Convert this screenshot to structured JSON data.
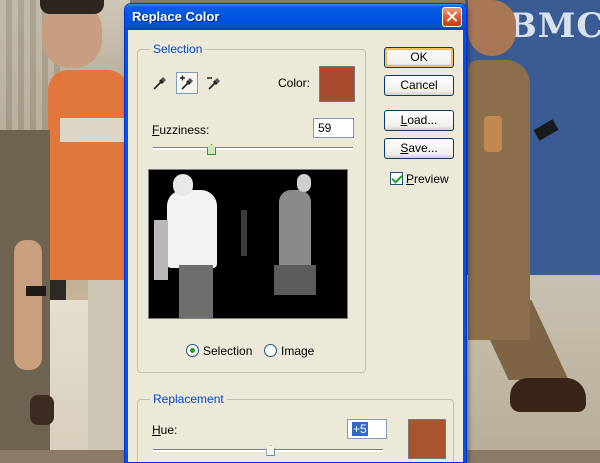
{
  "background": {
    "sign_text": "BMC"
  },
  "dialog": {
    "title": "Replace Color",
    "selection": {
      "group_label": "Selection",
      "tools": [
        "eyedropper-icon",
        "eyedropper-add-icon",
        "eyedropper-subtract-icon"
      ],
      "active_tool_index": 1,
      "color_label": "Color:",
      "color_value": "#a84a2e",
      "fuzziness_label": "Fuzziness:",
      "fuzziness_value": "59",
      "fuzziness_slider_fraction": 0.29,
      "radio_selection_label": "Selection",
      "radio_image_label": "Image",
      "selected_radio": "selection"
    },
    "replacement": {
      "group_label": "Replacement",
      "hue_label": "Hue:",
      "hue_value": "+5",
      "result_color": "#a9532f",
      "hue_slider_fraction": 0.51
    },
    "buttons": {
      "ok": "OK",
      "cancel": "Cancel",
      "load": "Load...",
      "save": "Save..."
    },
    "preview": {
      "label": "Preview",
      "checked": true
    }
  },
  "colors": {
    "titlebar": "#0054e3",
    "group_label": "#0046d5",
    "dialog_bg": "#ece9d8"
  }
}
